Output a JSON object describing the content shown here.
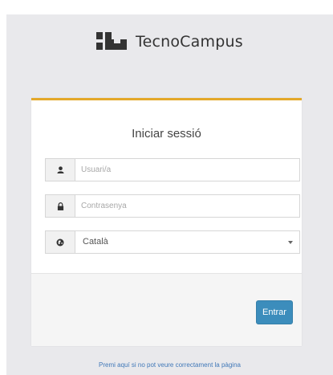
{
  "topbar": {
    "prefix_text": "",
    "link_text": ""
  },
  "brand": {
    "name": "TecnoCampus",
    "logo_icon": "tecnocampus-logo-icon"
  },
  "login": {
    "title": "Iniciar sessió",
    "username": {
      "icon": "user-icon",
      "placeholder": "Usuari/a",
      "value": ""
    },
    "password": {
      "icon": "lock-icon",
      "placeholder": "Contrasenya",
      "value": ""
    },
    "language": {
      "icon": "globe-icon",
      "selected": "Català"
    },
    "submit_label": "Entrar"
  },
  "footer": {
    "help_link": "Premi aquí si no pot veure correctament la pàgina"
  },
  "colors": {
    "accent_border": "#e4a82a",
    "button": "#3c8dbc",
    "background": "#e9e9ec",
    "link": "#4078b8"
  }
}
